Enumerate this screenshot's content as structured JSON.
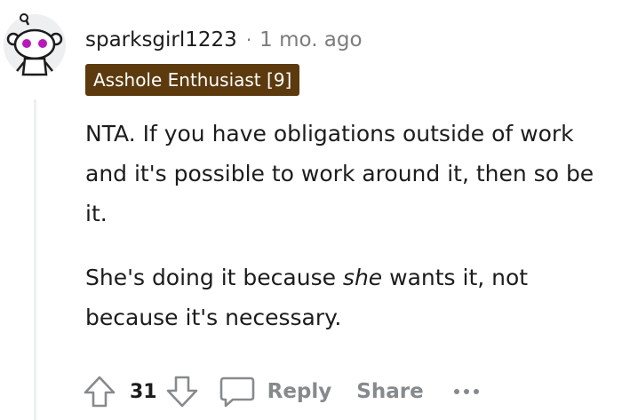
{
  "comment": {
    "username": "sparksgirl1223",
    "separator": "·",
    "time": "1 mo. ago",
    "flair": "Asshole Enthusiast [9]",
    "flair_color": "#5c3a0e",
    "avatar_icon": "snoo-avatar-icon",
    "paragraph1": "NTA. If you have obligations outside of work and it's possible to work around it, then so be it.",
    "paragraph2_start": "She's doing it because ",
    "paragraph2_emphasis": "she",
    "paragraph2_end": " wants it, not because it's necessary."
  },
  "actions": {
    "upvote_icon": "upvote-arrow-icon",
    "score": "31",
    "downvote_icon": "downvote-arrow-icon",
    "reply_icon": "speech-bubble-icon",
    "reply_label": "Reply",
    "share_label": "Share",
    "more_icon": "ellipsis-icon"
  },
  "colors": {
    "text": "#1c1c1c",
    "muted": "#7c7c7c",
    "action": "#878a8c",
    "thread_line": "#edeff1"
  }
}
